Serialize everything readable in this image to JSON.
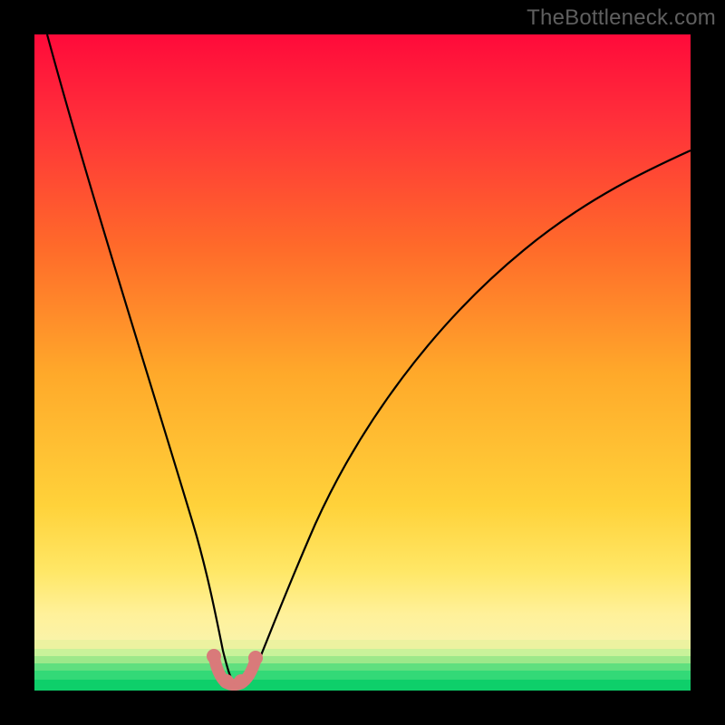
{
  "watermark": "TheBottleneck.com",
  "chart_data": {
    "type": "line",
    "title": "",
    "xlabel": "",
    "ylabel": "",
    "xlim": [
      0,
      100
    ],
    "ylim": [
      0,
      100
    ],
    "grid": false,
    "series": [
      {
        "name": "bottleneck-curve",
        "x": [
          2,
          5,
          10,
          15,
          20,
          23,
          25,
          27,
          28,
          29,
          30,
          31,
          32,
          34,
          37,
          42,
          50,
          60,
          72,
          85,
          100
        ],
        "y": [
          100,
          88,
          69,
          50,
          30,
          17,
          9,
          3,
          1,
          0,
          0,
          0,
          1,
          3,
          9,
          20,
          36,
          52,
          66,
          76,
          83
        ]
      }
    ],
    "annotations": [
      {
        "name": "marker-left",
        "x": 27,
        "y": 4
      },
      {
        "name": "marker-mid1",
        "x": 28.5,
        "y": 1
      },
      {
        "name": "marker-mid2",
        "x": 31.5,
        "y": 1
      },
      {
        "name": "marker-right",
        "x": 33,
        "y": 4
      }
    ],
    "gradient": {
      "top": "#ff0a3a",
      "upper_mid": "#ff6a2a",
      "mid": "#ffb92a",
      "lower_mid": "#ffe766",
      "band_yellow": "#faf39a",
      "band_lime_light": "#c9f29a",
      "band_lime": "#9de88a",
      "band_green": "#33d977",
      "bottom": "#0ecf6a"
    }
  }
}
